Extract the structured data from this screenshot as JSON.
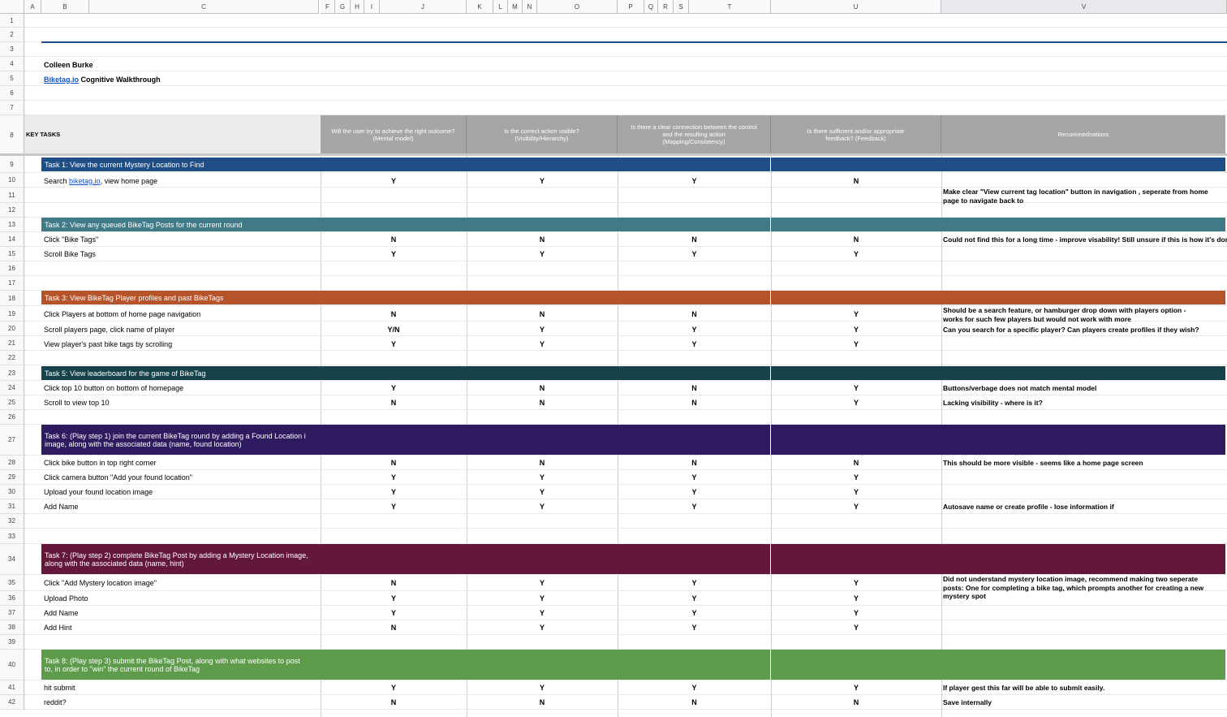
{
  "columns": [
    "A",
    "B",
    "C",
    "F",
    "G",
    "H",
    "I",
    "J",
    "K",
    "L",
    "M",
    "N",
    "O",
    "P",
    "Q",
    "R",
    "S",
    "T",
    "U",
    "V"
  ],
  "rows": [
    "1",
    "2",
    "3",
    "4",
    "5",
    "6",
    "7",
    "8",
    "9",
    "10",
    "11",
    "12",
    "13",
    "14",
    "15",
    "16",
    "17",
    "18",
    "19",
    "20",
    "21",
    "22",
    "23",
    "24",
    "25",
    "26",
    "27",
    "28",
    "29",
    "30",
    "31",
    "32",
    "33",
    "34",
    "35",
    "36",
    "37",
    "38",
    "39",
    "40",
    "41",
    "42"
  ],
  "author": "Colleen Burke",
  "project_link": "Biketag.io",
  "project_rest": " Cognitive Walkthrough",
  "header": {
    "key_tasks": "KEY TASKS",
    "q1": "Will the user try to achieve the right outcome?\n(Mental model)",
    "q2": "Is the correct action visible?\n(Visibility/Hierarchy)",
    "q3": "Is there a clear connection between the control and the resulting action\n(Mapping/Consistency)",
    "q4": "Is there sufficient and/or appropriate feedback? (Feedback)",
    "rec": "Recommednations"
  },
  "tasks": {
    "t1": "Task 1: View the current Mystery Location to Find",
    "t2": "Task 2: View any queued BikeTag Posts for the current round",
    "t3": "Task 3: View BikeTag Player profiles and past BikeTags",
    "t5": "Task 5: View leaderboard for the game of BikeTag",
    "t6": "Task 6: (Play step 1) join the current BikeTag round by adding a Found Location i image, along with the associated data (name, found location)",
    "t7": "Task 7: (Play step 2) complete BikeTag Post by adding a Mystery Location image, along with the associated data (name, hint)",
    "t8": "Task 8: (Play step 3) submit the BikeTag Post, along with what websites to post to, in order to \"win\" the current round of BikeTag"
  },
  "steps": {
    "r10_pre": "Search ",
    "r10_link": "biketag.io",
    "r10_post": ", view home page",
    "r14": "Click \"Bike Tags\"",
    "r15": "Scroll Bike Tags",
    "r19": "Click Players at bottom of home page navigation",
    "r20": "Scroll players page, click name of player",
    "r21": "View player's past bike tags by scrolling",
    "r24": "Click top 10 button on bottom of homepage",
    "r25": "Scroll to view top 10",
    "r28": "Click bike button in top right corner",
    "r29": "Click camera button \"Add your found location\"",
    "r30": "Upload your found location image",
    "r31": "Add Name",
    "r35": "Click \"Add Mystery location image\"",
    "r36": "Upload Photo",
    "r37": "Add Name",
    "r38": "Add Hint",
    "r41": "hit submit",
    "r42": "reddit?"
  },
  "answers": {
    "r10": [
      "Y",
      "Y",
      "Y",
      "N"
    ],
    "r14": [
      "N",
      "N",
      "N",
      "N"
    ],
    "r15": [
      "Y",
      "Y",
      "Y",
      "Y"
    ],
    "r19": [
      "N",
      "N",
      "N",
      "Y"
    ],
    "r20": [
      "Y/N",
      "Y",
      "Y",
      "Y"
    ],
    "r21": [
      "Y",
      "Y",
      "Y",
      "Y"
    ],
    "r24": [
      "Y",
      "N",
      "N",
      "Y"
    ],
    "r25": [
      "N",
      "N",
      "N",
      "Y"
    ],
    "r28": [
      "N",
      "N",
      "N",
      "N"
    ],
    "r29": [
      "Y",
      "Y",
      "Y",
      "Y"
    ],
    "r30": [
      "Y",
      "Y",
      "Y",
      "Y"
    ],
    "r31": [
      "Y",
      "Y",
      "Y",
      "Y"
    ],
    "r35": [
      "N",
      "Y",
      "Y",
      "Y"
    ],
    "r36": [
      "Y",
      "Y",
      "Y",
      "Y"
    ],
    "r37": [
      "Y",
      "Y",
      "Y",
      "Y"
    ],
    "r38": [
      "N",
      "Y",
      "Y",
      "Y"
    ],
    "r41": [
      "Y",
      "Y",
      "Y",
      "Y"
    ],
    "r42": [
      "N",
      "N",
      "N",
      "N"
    ]
  },
  "recs": {
    "r11": "Make clear \"View current tag location\" button in navigation , seperate from home page to navigate back to",
    "r14": "Could not find this for a long time - improve visability! Still unsure if this is how it's done",
    "r19": "Should be a search feature, or hamburger drop down with players option - works for such few players but would not work with more",
    "r20": "Can you search for a specific player? Can players create profiles if they wish?",
    "r24": "Buttons/verbage does not match mental model",
    "r25": "Lacking visibility - where is it?",
    "r28": "This should be more visible - seems like a home page screen",
    "r31": "Autosave name or create profile - lose information if",
    "r35": "Did not understand mystery location image, recommend making two seperate posts: One for completing a bike tag, which prompts another for creating a new mystery spot",
    "r41": "If player gest this far will be able to submit easily.",
    "r42": "Save internally"
  },
  "colors": {
    "t1": "#1f4e87",
    "t2": "#3f7a86",
    "t3": "#b5532a",
    "t5": "#15424b",
    "t6": "#2e1a5e",
    "t7": "#63173b",
    "t8": "#5e9c4c",
    "header_gray": "#a6a6a6"
  }
}
